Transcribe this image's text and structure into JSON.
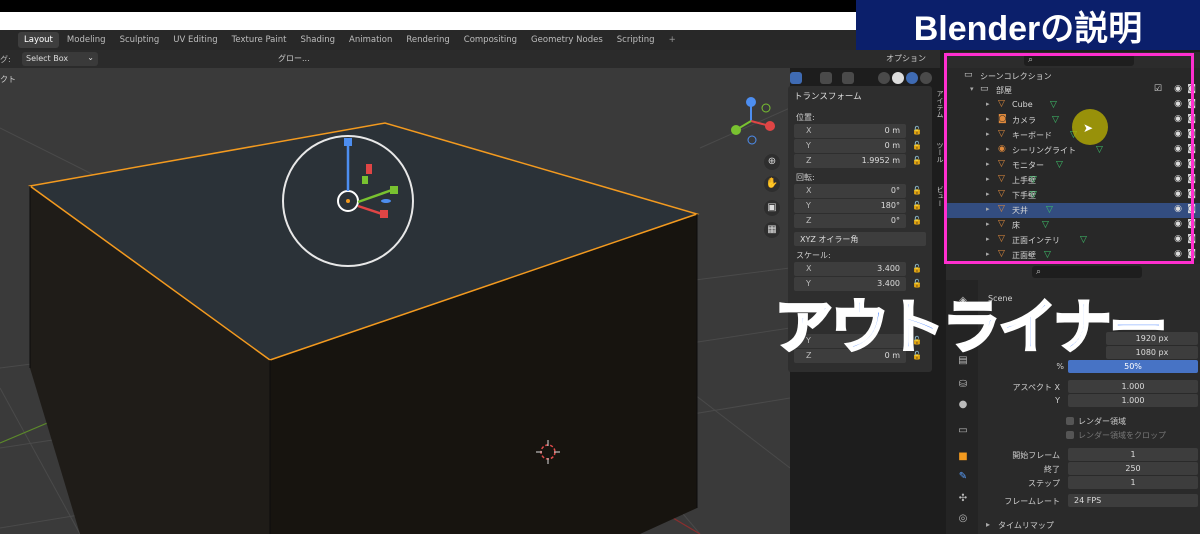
{
  "brand_caption": "Blenderの説明",
  "overlay_label": "アウトライナー",
  "workspace_tabs": [
    {
      "label": "Layout",
      "active": true
    },
    {
      "label": "Modeling"
    },
    {
      "label": "Sculpting"
    },
    {
      "label": "UV Editing"
    },
    {
      "label": "Texture Paint"
    },
    {
      "label": "Shading"
    },
    {
      "label": "Animation"
    },
    {
      "label": "Rendering"
    },
    {
      "label": "Compositing"
    },
    {
      "label": "Geometry Nodes"
    },
    {
      "label": "Scripting"
    },
    {
      "label": "+"
    }
  ],
  "header": {
    "left_label": "グ:",
    "select_mode": "Select Box",
    "transform_orientation": "グロー...",
    "options_label": "オプション",
    "viewport_label": "クト"
  },
  "npanel": {
    "title": "トランスフォーム",
    "location_label": "位置:",
    "location": [
      {
        "axis": "X",
        "value": "0 m"
      },
      {
        "axis": "Y",
        "value": "0 m"
      },
      {
        "axis": "Z",
        "value": "1.9952 m"
      }
    ],
    "rotation_label": "回転:",
    "rotation": [
      {
        "axis": "X",
        "value": "0°"
      },
      {
        "axis": "Y",
        "value": "180°"
      },
      {
        "axis": "Z",
        "value": "0°"
      }
    ],
    "rotation_mode": "XYZ オイラー角",
    "scale_label": "スケール:",
    "scale": [
      {
        "axis": "X",
        "value": "3.400"
      },
      {
        "axis": "Y",
        "value": "3.400"
      }
    ],
    "dimensions_partial": [
      {
        "axis": "Y",
        "value": ""
      },
      {
        "axis": "Z",
        "value": "0 m"
      }
    ],
    "tabs": [
      "アイテム",
      "ツール",
      "ビュー"
    ]
  },
  "outliner": {
    "root": "シーンコレクション",
    "collection": "部屋",
    "items": [
      {
        "name": "Cube",
        "selected": false
      },
      {
        "name": "カメラ",
        "selected": false
      },
      {
        "name": "キーボード",
        "selected": false
      },
      {
        "name": "シーリングライト",
        "selected": false
      },
      {
        "name": "モニター",
        "selected": false
      },
      {
        "name": "上手壁",
        "selected": false
      },
      {
        "name": "下手壁",
        "selected": false
      },
      {
        "name": "天井",
        "selected": true
      },
      {
        "name": "床",
        "selected": false
      },
      {
        "name": "正面インテリ",
        "selected": false
      },
      {
        "name": "正面壁",
        "selected": false
      }
    ]
  },
  "properties": {
    "scene_label": "Scene",
    "res_x": "1920 px",
    "res_y": "1080 px",
    "percent_label": "%",
    "percent": "50%",
    "aspect_x_label": "アスペクト X",
    "aspect_x": "1.000",
    "aspect_y_label": "Y",
    "aspect_y": "1.000",
    "render_region": "レンダー領域",
    "crop_region": "レンダー領域をクロップ",
    "frame_start_label": "開始フレーム",
    "frame_start": "1",
    "frame_end_label": "終了",
    "frame_end": "250",
    "frame_step_label": "ステップ",
    "frame_step": "1",
    "fps_label": "フレームレート",
    "fps": "24 FPS",
    "time_remap": "タイムリマップ"
  },
  "colors": {
    "selected_edge": "#f39a1f",
    "highlight_box": "#ff2fcf",
    "outliner_selected": "#334d80",
    "brand_bg": "#0b1f6b",
    "overlay_text": "#0d5bff"
  }
}
